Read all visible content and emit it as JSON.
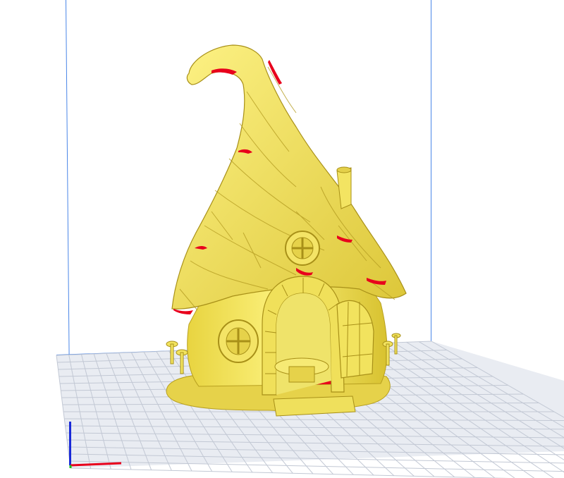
{
  "app": {
    "window_title": ""
  },
  "scene": {
    "model_name": "",
    "model_color": "#f2e55c",
    "overhang_color": "#e8001c",
    "plate_color": "#e9ecf2",
    "grid_color": "#c2c8d4",
    "volume_edge_color": "#4a86e8",
    "axis_x_color": "#e8001c",
    "axis_y_color": "#1a2ad8",
    "axis_z_color": "#1ac21a"
  }
}
